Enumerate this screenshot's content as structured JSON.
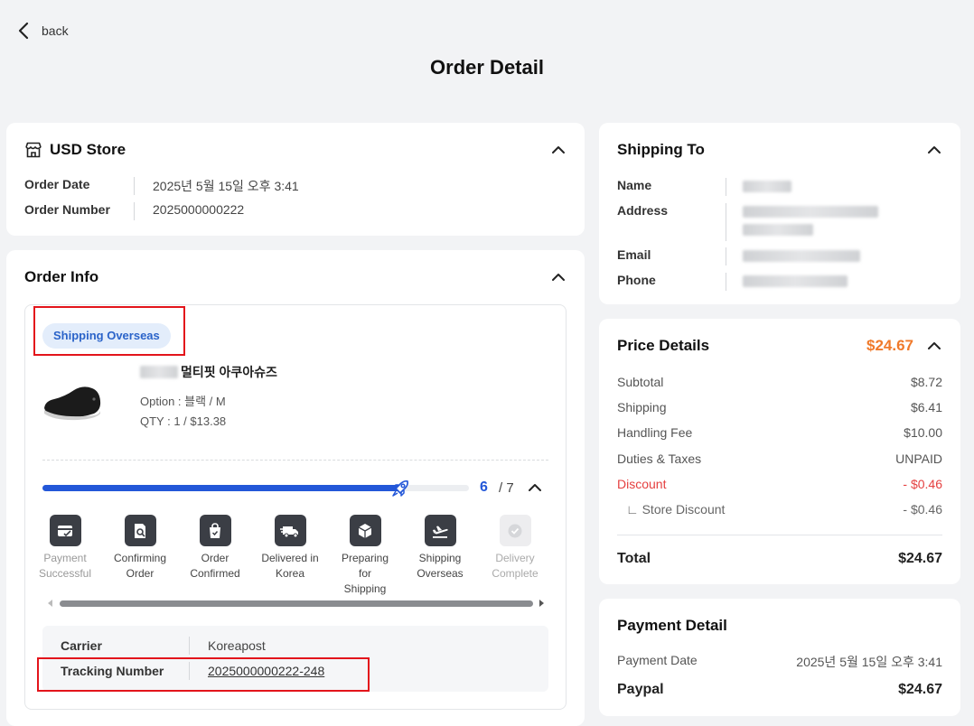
{
  "nav": {
    "back_label": "back"
  },
  "page": {
    "title": "Order Detail"
  },
  "store": {
    "title": "USD Store",
    "order_date_label": "Order Date",
    "order_date": "2025년 5월 15일 오후 3:41",
    "order_number_label": "Order Number",
    "order_number": "2025000000222"
  },
  "order_info": {
    "title": "Order Info",
    "badge": "Shipping Overseas",
    "product": {
      "name": "멀티핏 아쿠아슈즈",
      "option": "Option : 블랙 / M",
      "qty": "QTY : 1 / $13.38"
    },
    "progress": {
      "current": "6",
      "total": "/ 7",
      "fraction": 0.84
    },
    "steps": [
      {
        "label": "Payment Successful",
        "icon": "payment-card-icon"
      },
      {
        "label": "Confirming Order",
        "icon": "document-search-icon"
      },
      {
        "label": "Order Confirmed",
        "icon": "shopping-bag-icon"
      },
      {
        "label": "Delivered in Korea",
        "icon": "delivery-truck-icon"
      },
      {
        "label": "Preparing for Shipping",
        "icon": "package-box-icon"
      },
      {
        "label": "Shipping Overseas",
        "icon": "airplane-icon"
      },
      {
        "label": "Delivery Complete",
        "icon": "check-circle-icon"
      }
    ],
    "carrier_label": "Carrier",
    "carrier": "Koreapost",
    "tracking_label": "Tracking Number",
    "tracking_number": "2025000000222-248"
  },
  "shipping_to": {
    "title": "Shipping To",
    "name_label": "Name",
    "address_label": "Address",
    "email_label": "Email",
    "phone_label": "Phone"
  },
  "price": {
    "title": "Price Details",
    "total_top": "$24.67",
    "rows": [
      {
        "label": "Subtotal",
        "value": "$8.72"
      },
      {
        "label": "Shipping",
        "value": "$6.41"
      },
      {
        "label": "Handling Fee",
        "value": "$10.00"
      },
      {
        "label": "Duties & Taxes",
        "value": "UNPAID"
      },
      {
        "label": "Discount",
        "value": "- $0.46"
      },
      {
        "label": "∟  Store Discount",
        "value": "- $0.46"
      }
    ],
    "total_label": "Total",
    "total": "$24.67"
  },
  "payment": {
    "title": "Payment Detail",
    "date_label": "Payment Date",
    "date": "2025년 5월 15일 오후 3:41",
    "method": "Paypal",
    "amount": "$24.67"
  },
  "colors": {
    "accent": "#2357d8",
    "price_orange": "#f07a2b",
    "discount_red": "#e54040",
    "highlight_red": "#e3141b"
  }
}
